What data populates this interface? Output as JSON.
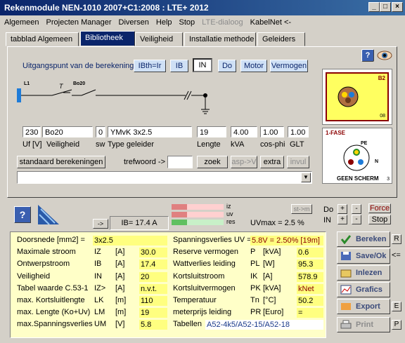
{
  "window": {
    "title": "Rekenmodule NEN-1010 2007+C1:2008 : LTE+ 2012"
  },
  "menu": [
    "Algemeen",
    "Projecten Manager",
    "Diversen",
    "Help",
    "Stop",
    "LTE-dialoog",
    "KabelNet <-"
  ],
  "tabs": [
    "tabblad Algemeen",
    "Bibliotheek",
    "Veiligheid",
    "Installatie methode",
    "Geleiders"
  ],
  "calc": {
    "uitgangspunt_label": "Uitgangspunt van de berekening",
    "buttons": [
      "IBth=Ir",
      "IB",
      "IN",
      "Do",
      "Motor",
      "Vermogen"
    ],
    "diagram_l1": "L1",
    "diagram_t": "T",
    "diagram_bo": "Bo20"
  },
  "inputs": {
    "uf": "230",
    "veiligheid": "Bo20",
    "sw": "0",
    "type": "YMvK 3x2.5",
    "lengte": "19",
    "kva": "4.00",
    "cosphi": "1.00",
    "glt": "1.00"
  },
  "input_labels": {
    "uf": "Uf [V]",
    "veiligheid": "Veiligheid",
    "sw": "sw",
    "type": "Type geleider",
    "lengte": "Lengte",
    "kva": "kVA",
    "cosphi": "cos-phi",
    "glt": "GLT"
  },
  "search": {
    "std_button": "standaard berekeningen",
    "trefwoord": "trefwoord ->",
    "zoek": "zoek",
    "asp": "asp->V",
    "extra": "extra",
    "invul": "invul"
  },
  "right_panel": {
    "cable_label_top": "B2",
    "cable_label_bottom": "08",
    "fase": "1-FASE",
    "pe": "PE",
    "n": "N",
    "scherm": "GEEN SCHERM",
    "num": "3"
  },
  "status": {
    "arrow": "->",
    "ib_label": "IB=",
    "ib_value": "17.4 A",
    "bar_iz": "iz",
    "bar_uv": "uv",
    "bar_res": "res",
    "uvmax": "UVmax = 2.5 %",
    "st_m": "st->m",
    "do": "Do",
    "in": "IN",
    "plus": "+",
    "minus": "-",
    "force": "Force",
    "stop": "Stop",
    "bar_iz_level": 0.3,
    "bar_uv_level": 0.3,
    "bar_res_level": 0.3
  },
  "results_left": [
    {
      "label": "Doorsnede [mm2] =",
      "sym": "",
      "unit": "",
      "value": "3x2.5"
    },
    {
      "label": "Maximale stroom",
      "sym": "IZ",
      "unit": "[A]",
      "value": "30.0"
    },
    {
      "label": "Ontwerpstroom",
      "sym": "IB",
      "unit": "[A]",
      "value": "17.4"
    },
    {
      "label": "Veiligheid",
      "sym": "IN",
      "unit": "[A]",
      "value": "20"
    },
    {
      "label": "Tabel waarde C.53-1",
      "sym": "IZ>",
      "unit": "[A]",
      "value": "n.v.t."
    },
    {
      "label": "max. Kortsluitlengte",
      "sym": "LK",
      "unit": "[m]",
      "value": "110"
    },
    {
      "label": "max. Lengte (Ko+Uv)",
      "sym": "LM",
      "unit": "[m]",
      "value": "19"
    },
    {
      "label": "max.Spanningsverlies",
      "sym": "UM",
      "unit": "[V]",
      "value": "5.8"
    }
  ],
  "results_right": [
    {
      "label": "Spanningsverlies UV =",
      "sym": "",
      "unit": "",
      "value": "5.8V = 2.50% [19m]"
    },
    {
      "label": "Reserve vermogen",
      "sym": "P",
      "unit": "[kVA]",
      "value": "0.6"
    },
    {
      "label": "Wattverlies leiding",
      "sym": "PL",
      "unit": "[W]",
      "value": "95.3"
    },
    {
      "label": "Kortsluitstroom",
      "sym": "IK",
      "unit": "[A]",
      "value": "578.9"
    },
    {
      "label": "Kortsluitvermogen",
      "sym": "PK",
      "unit": "[kVA]",
      "value": "kNet"
    },
    {
      "label": "Temperatuur",
      "sym": "Tn",
      "unit": "[°C]",
      "value": "50.2"
    },
    {
      "label": "meterprijs leiding",
      "sym": "PR",
      "unit": "[Euro]",
      "value": "="
    },
    {
      "label": "Tabellen",
      "sym": "",
      "unit": "",
      "value": "A52-4k5/A52-15/A52-18"
    }
  ],
  "side_buttons": [
    "Bereken",
    "Save/Ok",
    "Inlezen",
    "Grafics",
    "Export",
    "Print"
  ],
  "side_keys": {
    "r": "R",
    "save": "<=",
    "e": "E",
    "p": "P"
  },
  "colors": {
    "accent": "#0a246a",
    "result_bg": "#ffffc8",
    "value_bg": "#ffff80"
  }
}
